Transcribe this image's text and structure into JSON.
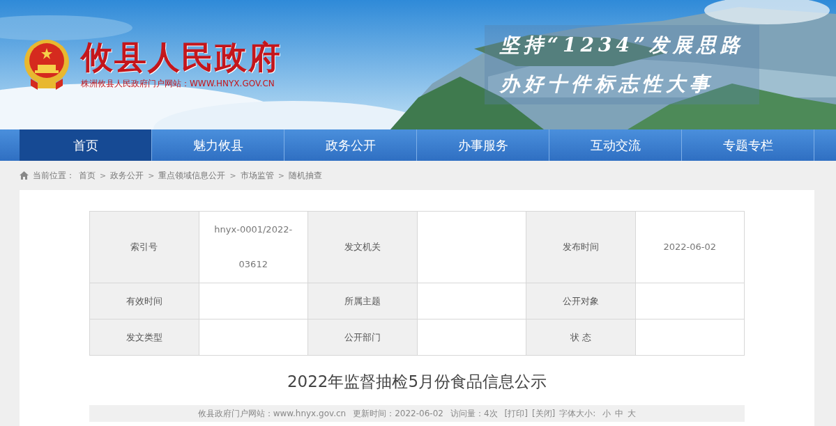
{
  "header": {
    "title": "攸县人民政府",
    "subtitle": "株洲攸县人民政府门户网站：WWW.HNYX.GOV.CN",
    "slogan": [
      "坚持“1234”发展思路",
      "办好十件标志性大事"
    ]
  },
  "nav": [
    {
      "label": "首页",
      "selected": true
    },
    {
      "label": "魅力攸县",
      "selected": false
    },
    {
      "label": "政务公开",
      "selected": false
    },
    {
      "label": "办事服务",
      "selected": false
    },
    {
      "label": "互动交流",
      "selected": false
    },
    {
      "label": "专题专栏",
      "selected": false
    }
  ],
  "breadcrumb": {
    "label": "当前位置：",
    "separator": ">",
    "items": [
      "首页",
      "政务公开",
      "重点领域信息公开",
      "市场监管",
      "随机抽查"
    ]
  },
  "info_table": {
    "rows": [
      [
        {
          "label": "索引号",
          "value": "hnyx-0001/2022-03612"
        },
        {
          "label": "发文机关"
        },
        {
          "label": "发布时间",
          "value": "2022-06-02"
        }
      ],
      [
        {
          "label": "有效时间"
        },
        {
          "label": "所属主题"
        },
        {
          "label": "公开对象"
        }
      ],
      [
        {
          "label": "发文类型"
        },
        {
          "label": "公开部门"
        },
        {
          "label": "状 态"
        }
      ]
    ]
  },
  "article": {
    "title": "2022年监督抽检5月份食品信息公示",
    "meta": [
      {
        "kind": "text",
        "text": "攸县政府门户网站：www.hnyx.gov.cn"
      },
      {
        "kind": "text",
        "text": "更新时间：2022-06-02"
      },
      {
        "kind": "text",
        "text": "访问量：4次"
      },
      {
        "kind": "link",
        "text": "[打印]"
      },
      {
        "kind": "link",
        "text": "[关闭]"
      },
      {
        "kind": "text",
        "text": "字体大小:"
      },
      {
        "kind": "size",
        "text": "小"
      },
      {
        "kind": "size",
        "text": "中"
      },
      {
        "kind": "size",
        "text": "大"
      }
    ]
  }
}
